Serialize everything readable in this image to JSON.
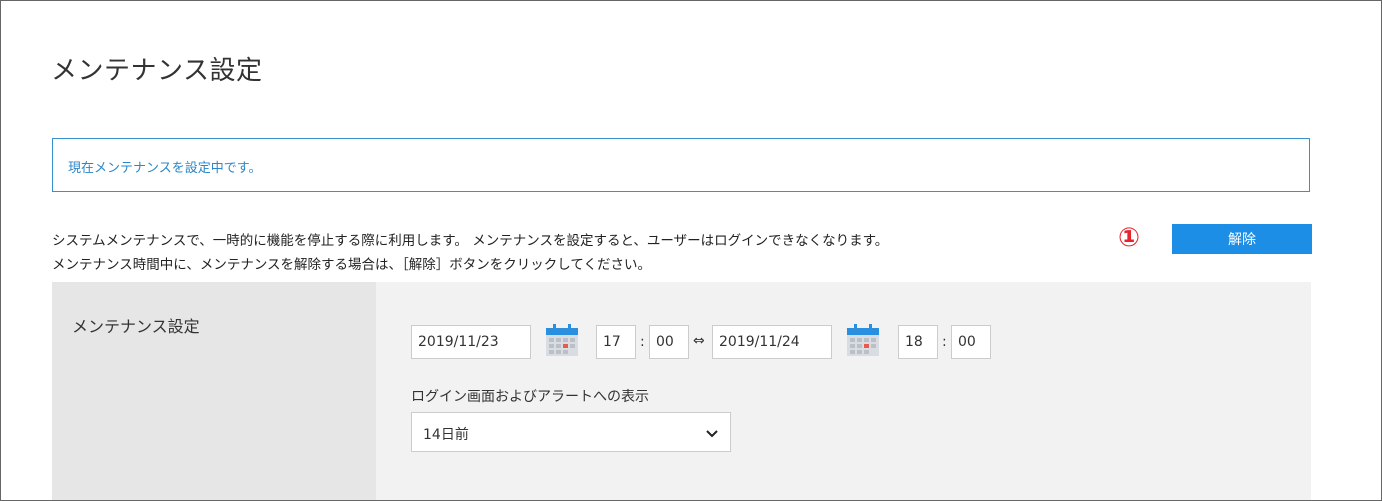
{
  "page": {
    "title": "メンテナンス設定"
  },
  "notice": {
    "text": "現在メンテナンスを設定中です。"
  },
  "description": {
    "line1": "システムメンテナンスで、一時的に機能を停止する際に利用します。 メンテナンスを設定すると、ユーザーはログインできなくなります。",
    "line2": "メンテナンス時間中に、メンテナンスを解除する場合は、［解除］ボタンをクリックしてください。"
  },
  "annotation": {
    "marker": "①"
  },
  "actions": {
    "release_label": "解除"
  },
  "settings": {
    "label": "メンテナンス設定",
    "start": {
      "date": "2019/11/23",
      "hour": "17",
      "minute": "00"
    },
    "range_separator": "⇔",
    "time_separator": ":",
    "end": {
      "date": "2019/11/24",
      "hour": "18",
      "minute": "00"
    },
    "alert_label": "ログイン画面およびアラートへの表示",
    "alert_value": "14日前"
  },
  "colors": {
    "accent": "#1c8ee6",
    "notice_border": "#3a8fd0",
    "notice_text": "#2b87c8",
    "marker": "#e8232b",
    "label_bg": "#e6e6e6",
    "body_bg": "#f2f2f2"
  },
  "icons": {
    "calendar": "calendar-icon",
    "dropdown": "chevron-down-icon"
  }
}
